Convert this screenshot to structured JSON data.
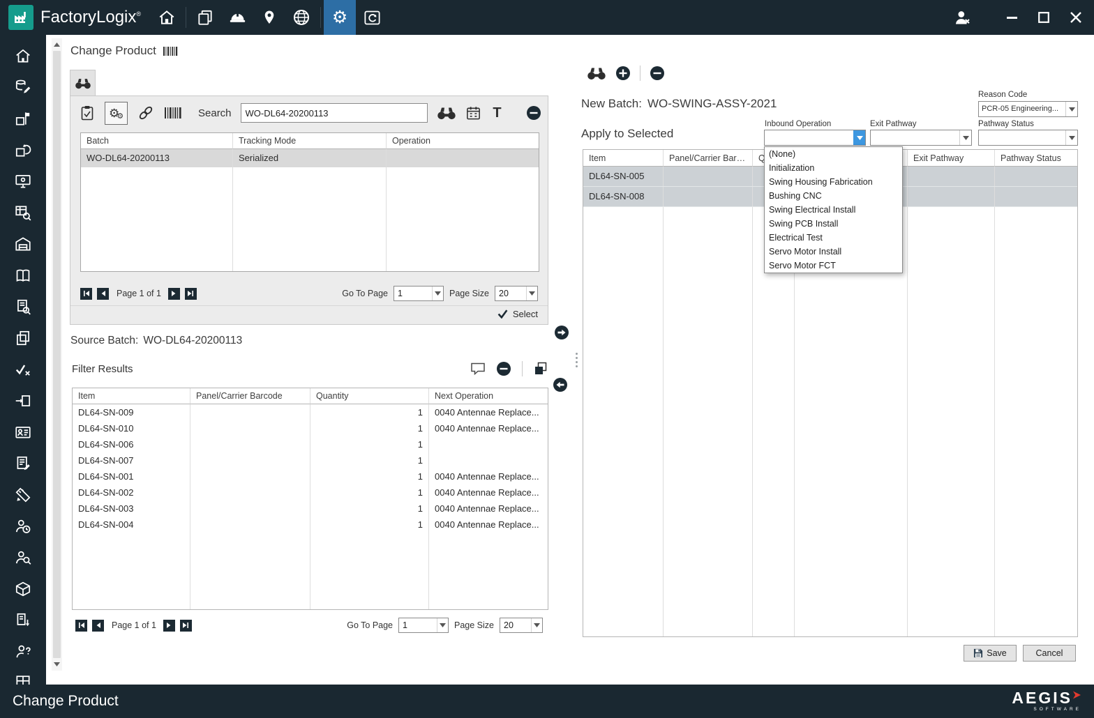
{
  "titlebar": {
    "app_name": "FactoryLogix",
    "registered": "®"
  },
  "page": {
    "title": "Change Product"
  },
  "glyphs": {
    "text_tool": "T"
  },
  "sidebar": {
    "icons": [
      "home",
      "data-editor",
      "product-definition",
      "batch-history",
      "machine-interface",
      "data-query",
      "warehouse",
      "documentation",
      "document-search",
      "copy-batch",
      "verification",
      "material-transfer",
      "badge",
      "report-editor",
      "engineering-tools",
      "operator-time",
      "personnel-search",
      "packaging",
      "material-export",
      "operator-assist",
      "materials-grid"
    ]
  },
  "search_panel": {
    "search_label": "Search",
    "search_value": "WO-DL64-20200113",
    "table": {
      "columns": [
        "Batch",
        "Tracking Mode",
        "Operation"
      ],
      "rows": [
        {
          "batch": "WO-DL64-20200113",
          "tracking_mode": "Serialized",
          "operation": ""
        }
      ]
    },
    "pagination": {
      "page_text": "Page 1 of 1",
      "go_to_page_label": "Go To Page",
      "go_to_page_value": "1",
      "page_size_label": "Page Size",
      "page_size_value": "20"
    },
    "select_label": "Select"
  },
  "source_batch": {
    "label": "Source Batch:",
    "value": "WO-DL64-20200113"
  },
  "filter_results": {
    "title": "Filter Results",
    "table": {
      "columns": [
        "Item",
        "Panel/Carrier Barcode",
        "Quantity",
        "Next Operation"
      ],
      "rows": [
        {
          "item": "DL64-SN-009",
          "panel_carrier_barcode": "",
          "quantity": "1",
          "next_operation": "0040 Antennae Replace..."
        },
        {
          "item": "DL64-SN-010",
          "panel_carrier_barcode": "",
          "quantity": "1",
          "next_operation": "0040 Antennae Replace..."
        },
        {
          "item": "DL64-SN-006",
          "panel_carrier_barcode": "",
          "quantity": "1",
          "next_operation": ""
        },
        {
          "item": "DL64-SN-007",
          "panel_carrier_barcode": "",
          "quantity": "1",
          "next_operation": ""
        },
        {
          "item": "DL64-SN-001",
          "panel_carrier_barcode": "",
          "quantity": "1",
          "next_operation": "0040 Antennae Replace..."
        },
        {
          "item": "DL64-SN-002",
          "panel_carrier_barcode": "",
          "quantity": "1",
          "next_operation": "0040 Antennae Replace..."
        },
        {
          "item": "DL64-SN-003",
          "panel_carrier_barcode": "",
          "quantity": "1",
          "next_operation": "0040 Antennae Replace..."
        },
        {
          "item": "DL64-SN-004",
          "panel_carrier_barcode": "",
          "quantity": "1",
          "next_operation": "0040 Antennae Replace..."
        }
      ]
    },
    "pagination": {
      "page_text": "Page 1 of 1",
      "go_to_page_label": "Go To Page",
      "go_to_page_value": "1",
      "page_size_label": "Page Size",
      "page_size_value": "20"
    }
  },
  "new_batch_panel": {
    "new_batch_label": "New Batch:",
    "new_batch_value": "WO-SWING-ASSY-2021",
    "reason_code_label": "Reason Code",
    "reason_code_value": "PCR-05 Engineering...",
    "apply_label": "Apply to Selected",
    "inbound_operation_label": "Inbound Operation",
    "exit_pathway_label": "Exit Pathway",
    "pathway_status_label": "Pathway Status",
    "inbound_operation_options": [
      "(None)",
      "Initialization",
      "Swing Housing Fabrication",
      "Bushing CNC",
      "Swing Electrical Install",
      "Swing PCB Install",
      "Electrical Test",
      "Servo Motor Install",
      "Servo Motor FCT"
    ],
    "table": {
      "columns": [
        "Item",
        "Panel/Carrier Barc...",
        "Qua...",
        "",
        "Exit Pathway",
        "Pathway Status"
      ],
      "rows": [
        {
          "item": "DL64-SN-005"
        },
        {
          "item": "DL64-SN-008"
        }
      ]
    },
    "save_label": "Save",
    "cancel_label": "Cancel"
  },
  "statusbar": {
    "title": "Change Product",
    "brand": "AEGIS",
    "brand_sub": "SOFTWARE"
  }
}
